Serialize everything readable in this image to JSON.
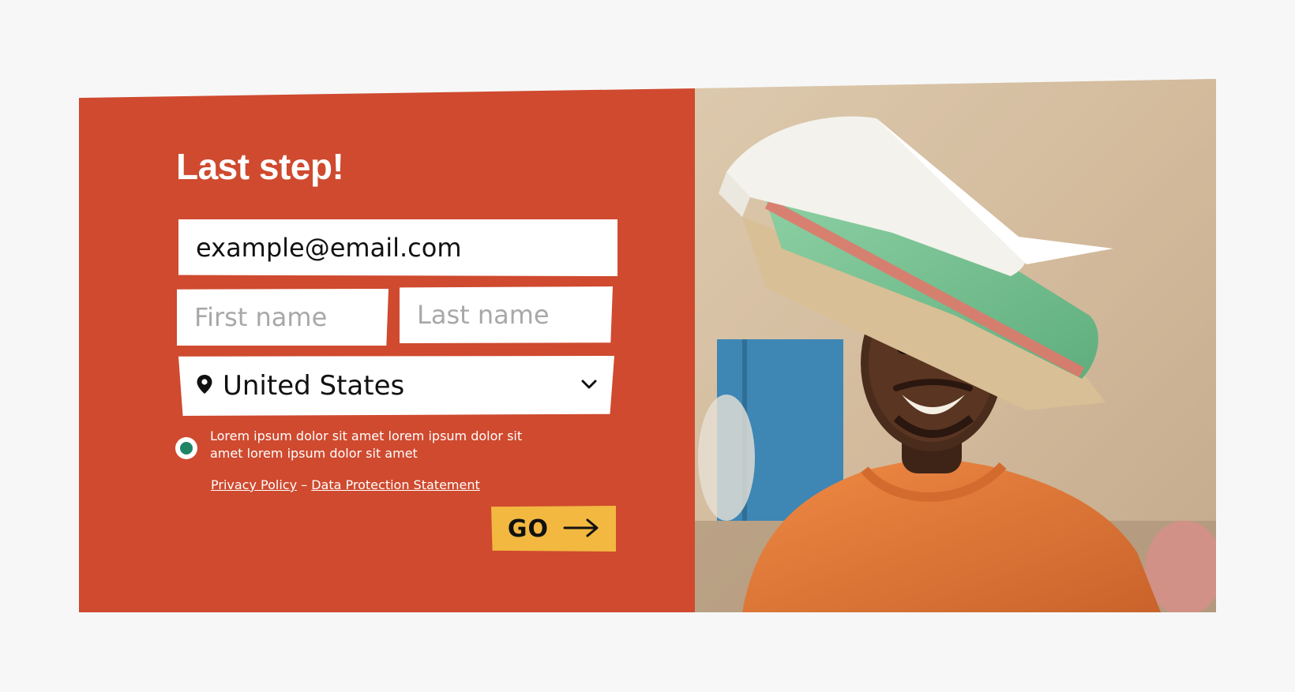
{
  "form": {
    "title": "Last step!",
    "email_value": "example@email.com",
    "first_name_placeholder": "First name",
    "last_name_placeholder": "Last name",
    "country_selected": "United States",
    "consent_text": "Lorem ipsum dolor sit amet lorem ipsum dolor sit amet lorem ipsum dolor sit amet",
    "privacy_link": "Privacy Policy",
    "separator": "–",
    "data_protection_link": "Data Protection Statement",
    "go_label": "GO"
  },
  "colors": {
    "panel_bg": "#cf4a2f",
    "button_bg": "#f2b840",
    "radio_dot": "#1f8466",
    "page_bg": "#f7f7f7"
  },
  "icons": {
    "country": "location-pin-icon",
    "dropdown": "chevron-down-icon",
    "go": "arrow-right-icon"
  }
}
